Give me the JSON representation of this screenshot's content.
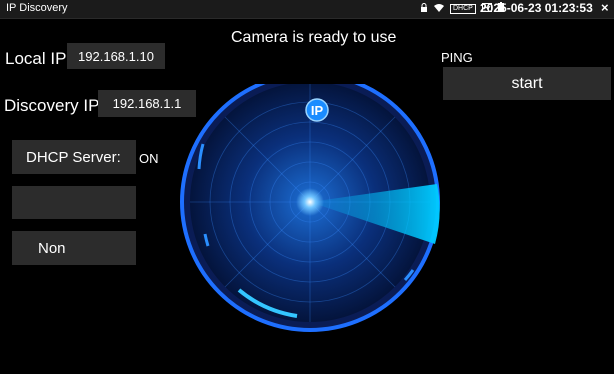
{
  "statusbar": {
    "app_title": "IP Discovery",
    "dhcp_icon": "DHCP",
    "datetime": "2025-06-23 01:23:53",
    "close": "×",
    "icons": [
      "lock-icon",
      "wifi-icon",
      "dhcp-icon",
      "screen-icon",
      "battery-icon"
    ]
  },
  "main": {
    "status_message": "Camera is ready to use",
    "local_ip_label": "Local IP:",
    "local_ip_value": "192.168.1.10",
    "discovery_ip_label": "Discovery IP:",
    "discovery_ip_value": "192.168.1.1",
    "dhcp_server_label": "DHCP Server:",
    "dhcp_server_state": "ON",
    "empty_button": "",
    "mode_button": "Non",
    "ping_label": "PING",
    "start_button": "start",
    "radar_badge": "IP"
  },
  "colors": {
    "background": "#000000",
    "field": "#2c2c2c",
    "radar_blue": "#1e8fff",
    "sweep_cyan": "#00c8ff"
  }
}
